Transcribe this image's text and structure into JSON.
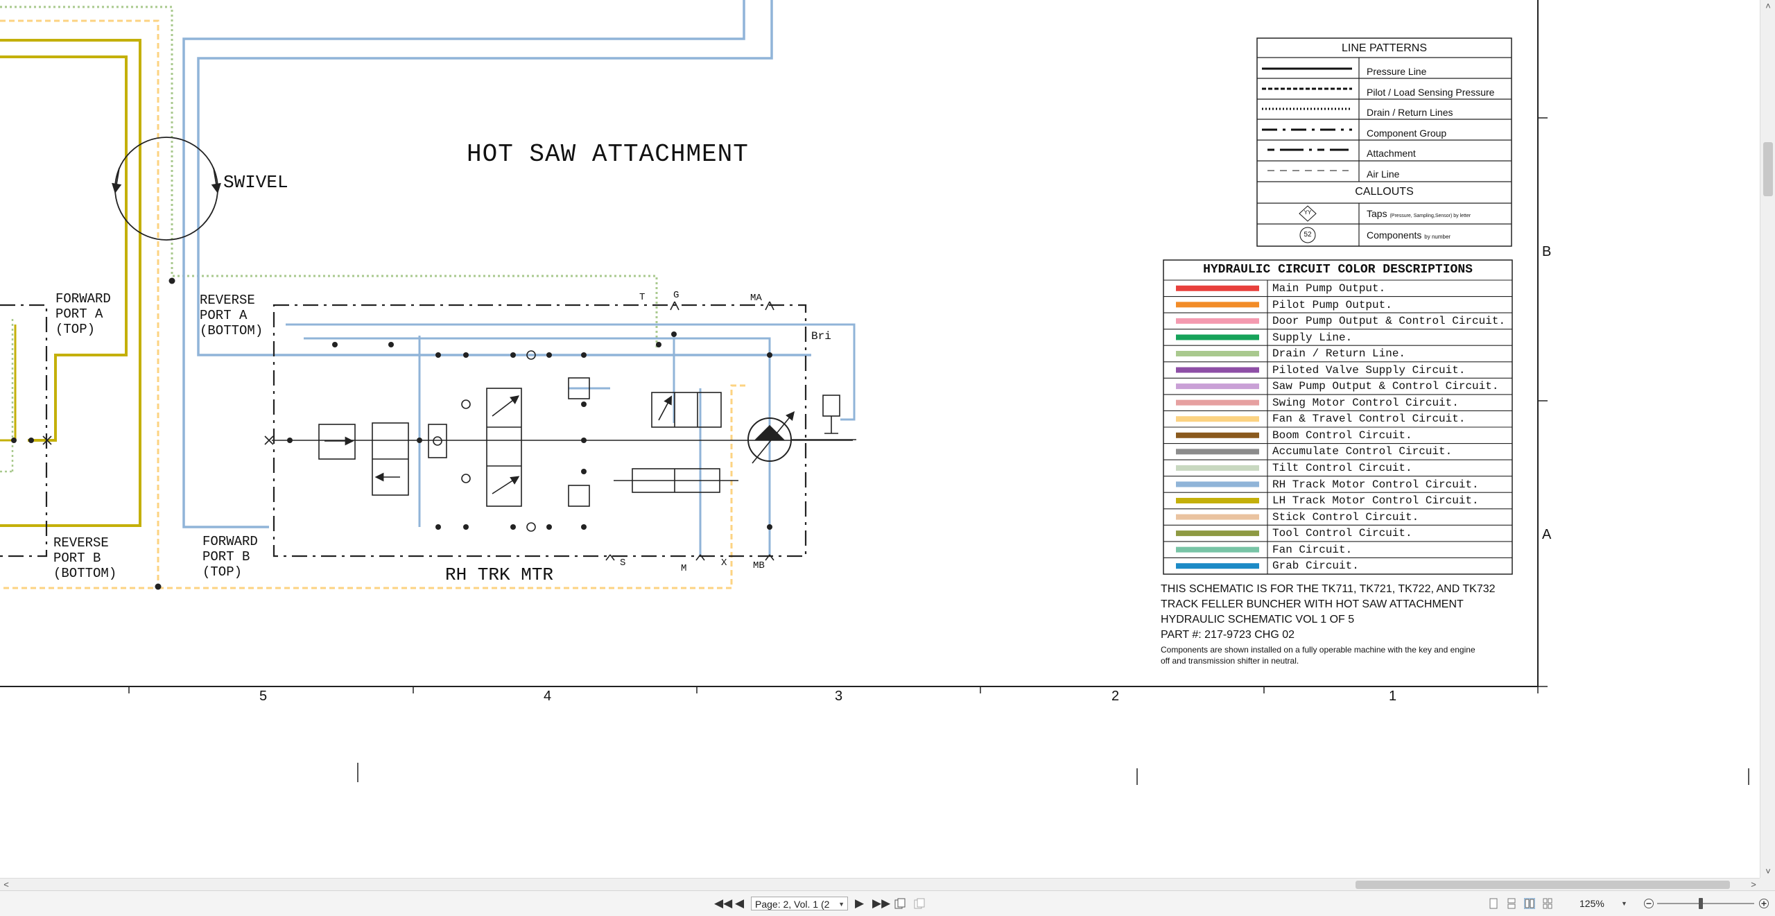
{
  "document": {
    "title": "HOT SAW ATTACHMENT",
    "labels": {
      "swivel": "SWIVEL",
      "forward_port_a": [
        "FORWARD",
        "PORT A",
        "(TOP)"
      ],
      "reverse_port_b": [
        "REVERSE",
        "PORT B",
        "(BOTTOM)"
      ],
      "reverse_port_a": [
        "REVERSE",
        "PORT A",
        "(BOTTOM)"
      ],
      "forward_port_b": [
        "FORWARD",
        "PORT B",
        "(TOP)"
      ],
      "rh_trk_mtr": "RH TRK MTR",
      "port_t": "T",
      "port_g": "G",
      "port_ma": "MA",
      "port_bri": "Bri",
      "port_s": "S",
      "port_m": "M",
      "port_x": "X",
      "port_mb": "MB"
    },
    "line_patterns": {
      "header": "LINE PATTERNS",
      "rows": [
        "Pressure Line",
        "Pilot / Load Sensing Pressure",
        "Drain / Return Lines",
        "Component Group",
        "Attachment",
        "Air Line"
      ],
      "callouts_header": "CALLOUTS",
      "taps_label": "Taps",
      "taps_note": "(Pressure, Sampling,Sensor) by letter",
      "taps_symbol": "YY",
      "components_label": "Components",
      "components_note": "by number",
      "components_symbol": "52"
    },
    "color_descriptions": {
      "header": "HYDRAULIC CIRCUIT COLOR DESCRIPTIONS",
      "rows": [
        {
          "label": "Main Pump Output.",
          "color": "#e8403c"
        },
        {
          "label": "Pilot Pump Output.",
          "color": "#f28c28"
        },
        {
          "label": "Door Pump Output & Control Circuit.",
          "color": "#f49ab0"
        },
        {
          "label": "Supply Line.",
          "color": "#16a35a"
        },
        {
          "label": "Drain / Return Line.",
          "color": "#a9c98e"
        },
        {
          "label": "Piloted Valve Supply Circuit.",
          "color": "#8e4fa6"
        },
        {
          "label": "Saw Pump Output & Control Circuit.",
          "color": "#c9a0d6"
        },
        {
          "label": "Swing Motor Control Circuit.",
          "color": "#e6a0a0"
        },
        {
          "label": "Fan & Travel Control Circuit.",
          "color": "#fcd382"
        },
        {
          "label": "Boom Control Circuit.",
          "color": "#8a5a1e"
        },
        {
          "label": "Accumulate Control Circuit.",
          "color": "#8c8c8c"
        },
        {
          "label": "Tilt Control Circuit.",
          "color": "#c8d8c0"
        },
        {
          "label": "RH Track Motor Control Circuit.",
          "color": "#90b4d8"
        },
        {
          "label": "LH Track Motor Control Circuit.",
          "color": "#c4b00a"
        },
        {
          "label": "Stick Control Circuit.",
          "color": "#eac3a0"
        },
        {
          "label": "Tool Control Circuit.",
          "color": "#8e9a42"
        },
        {
          "label": "Fan Circuit.",
          "color": "#78c4a6"
        },
        {
          "label": "Grab Circuit.",
          "color": "#1c8ac6"
        }
      ]
    },
    "notes": {
      "line1": "THIS SCHEMATIC IS FOR THE TK711, TK721, TK722, AND TK732",
      "line2": "TRACK FELLER BUNCHER WITH HOT SAW ATTACHMENT",
      "line3": "HYDRAULIC SCHEMATIC VOL 1 OF 5",
      "line4": "PART #: 217-9723 CHG 02",
      "fine1": "Components are shown installed on a fully operable machine with the key and engine",
      "fine2": "off and transmission shifter in neutral."
    },
    "grid": {
      "columns": [
        "5",
        "4",
        "3",
        "2",
        "1"
      ],
      "rows": [
        "B",
        "A"
      ]
    },
    "colors": {
      "rh_track": "#90b4d8",
      "lh_track": "#c4b00a",
      "drain": "#a9c98e",
      "fan_travel": "#fcd382"
    }
  },
  "statusbar": {
    "page_indicator": "Page: 2, Vol. 1 (2",
    "zoom": "125%",
    "icons": [
      "first-page-icon",
      "previous-page-icon",
      "next-page-icon",
      "last-page-icon",
      "single-page-view-icon",
      "continuous-view-icon",
      "two-page-view-icon",
      "book-view-icon",
      "zoom-out-icon",
      "zoom-in-icon"
    ]
  }
}
